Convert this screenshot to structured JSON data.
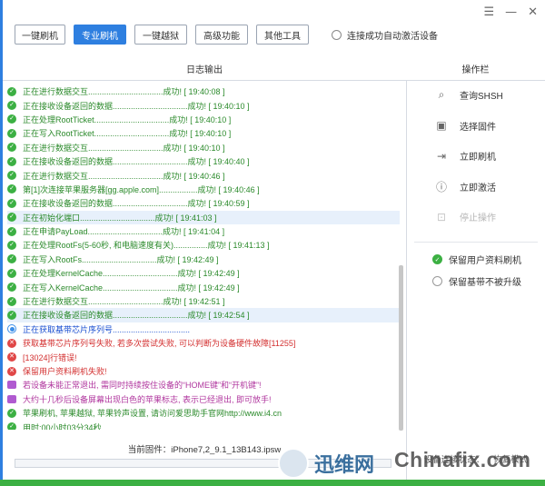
{
  "toolbar": {
    "buttons": [
      "一键刷机",
      "专业刷机",
      "一键越狱",
      "高级功能",
      "其他工具"
    ],
    "auto_activate_label": "连接成功自动激活设备"
  },
  "window_controls": [
    "☰",
    "—",
    "✕"
  ],
  "panels": {
    "log_title": "日志输出",
    "ops_title": "操作栏"
  },
  "log": [
    {
      "status": "ok",
      "text": "正在进行数据交互.................................成功! [ 19:40:08 ]"
    },
    {
      "status": "ok",
      "text": "正在接收设备返回的数据.................................成功! [ 19:40:10 ]"
    },
    {
      "status": "ok",
      "text": "正在处理RootTicket.................................成功! [ 19:40:10 ]"
    },
    {
      "status": "ok",
      "text": "正在写入RootTicket.................................成功! [ 19:40:10 ]"
    },
    {
      "status": "ok",
      "text": "正在进行数据交互.................................成功! [ 19:40:10 ]"
    },
    {
      "status": "ok",
      "text": "正在接收设备返回的数据.................................成功! [ 19:40:40 ]"
    },
    {
      "status": "ok",
      "text": "正在进行数据交互.................................成功! [ 19:40:46 ]"
    },
    {
      "status": "ok",
      "text": "第[1]次连接苹果服务器[gg.apple.com].................成功! [ 19:40:46 ]"
    },
    {
      "status": "ok",
      "text": "正在接收设备返回的数据.................................成功! [ 19:40:59 ]"
    },
    {
      "status": "ok",
      "text": "正在初始化端口.................................成功! [ 19:41:03 ]",
      "highlight": true
    },
    {
      "status": "ok",
      "text": "正在申请PayLoad.................................成功! [ 19:41:04 ]"
    },
    {
      "status": "ok",
      "text": "正在处理RootFs(5-60秒, 和电脑速度有关)...............成功! [ 19:41:13 ]"
    },
    {
      "status": "ok",
      "text": "正在写入RootFs.................................成功! [ 19:42:49 ]"
    },
    {
      "status": "ok",
      "text": "正在处理KernelCache.................................成功! [ 19:42:49 ]"
    },
    {
      "status": "ok",
      "text": "正在写入KernelCache.................................成功! [ 19:42:49 ]"
    },
    {
      "status": "ok",
      "text": "正在进行数据交互.................................成功! [ 19:42:51 ]"
    },
    {
      "status": "ok",
      "text": "正在接收设备返回的数据.................................成功! [ 19:42:54 ]",
      "highlight": true
    },
    {
      "status": "busy",
      "color": "blue",
      "text": "正在获取基带芯片序列号.................................."
    },
    {
      "status": "err",
      "color": "red",
      "text": "获取基带芯片序列号失败, 若多次尝试失败, 可以判断为设备硬件故障[11255]"
    },
    {
      "status": "err",
      "color": "red",
      "text": "[13024]行错误!"
    },
    {
      "status": "err",
      "color": "red",
      "text": "保留用户资料刷机失败!"
    },
    {
      "status": "tip",
      "color": "purple",
      "text": "若设备未能正常退出, 需同时持续按住设备的“HOME键”和“开机键”!"
    },
    {
      "status": "tip",
      "color": "purple",
      "text": "大约十几秒后设备屏幕出现白色的苹果标志, 表示已经退出, 即可放手!"
    },
    {
      "status": "ok",
      "color": "green",
      "text": "苹果刷机, 苹果越狱, 苹果铃声设置, 请访问爱思助手官网http://www.i4.cn"
    },
    {
      "status": "ok",
      "color": "green",
      "text": "用时:00小时03分34秒"
    }
  ],
  "ops": [
    {
      "label": "查询SHSH",
      "icon": "search-icon",
      "glyph": "⌕",
      "enabled": true
    },
    {
      "label": "选择固件",
      "icon": "cube-icon",
      "glyph": "▣",
      "enabled": true
    },
    {
      "label": "立即刷机",
      "icon": "flash-icon",
      "glyph": "⇥",
      "enabled": true
    },
    {
      "label": "立即激活",
      "icon": "alert-icon",
      "glyph": "ⓘ",
      "enabled": true
    },
    {
      "label": "停止操作",
      "icon": "stop-icon",
      "glyph": "⊡",
      "enabled": false
    }
  ],
  "options": [
    {
      "label": "保留用户资料刷机",
      "checked": true
    },
    {
      "label": "保留基带不被升级",
      "checked": false
    }
  ],
  "footer": {
    "firmware": "当前固件：iPhone7,2_9.1_13B143.ipsw",
    "device_status_label": "设备连接状态：",
    "device_status_value": "恢复模式"
  },
  "watermarks": {
    "left": "迅维网",
    "right": "Chinafix.com"
  }
}
